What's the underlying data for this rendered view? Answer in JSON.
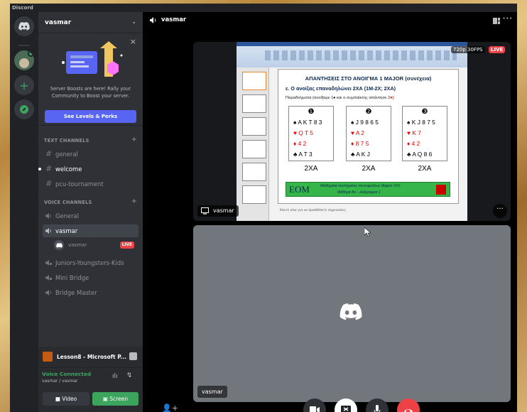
{
  "app": {
    "title": "Discord"
  },
  "server": {
    "name": "vasmar"
  },
  "boost": {
    "text": "Server Boosts are here! Rally your Community to Boost your server.",
    "button": "See Levels & Perks"
  },
  "categories": {
    "text": "TEXT CHANNELS",
    "voice": "VOICE CHANNELS"
  },
  "text_channels": [
    {
      "name": "general"
    },
    {
      "name": "welcome"
    },
    {
      "name": "pcu-tournament"
    }
  ],
  "voice_channels": [
    {
      "name": "General"
    },
    {
      "name": "vasmar"
    },
    {
      "name": "Juniors-Youngsters-Kids"
    },
    {
      "name": "Mini Bridge"
    },
    {
      "name": "Bridge Master"
    }
  ],
  "voice_user": {
    "name": "vasmar",
    "badge": "LIVE"
  },
  "stream_panel": {
    "title": "Lesson8 - Microsoft P..."
  },
  "voice_status": {
    "status": "Voice Connected",
    "sub": "vasmar / vasmar"
  },
  "buttons": {
    "video": "Video",
    "screen": "Screen"
  },
  "main": {
    "channel": "vasmar"
  },
  "stream": {
    "quality": "720p 30FPS",
    "live": "LIVE",
    "user": "vasmar"
  },
  "slide": {
    "title": "ΑΠΑΝΤΗΣΕΙΣ ΣΤΟ ΑΝΟΙΓΜΑ 1 MAJOR (συνέχεια)",
    "subtitle": "ε. Ο ανοίξας επαναδηλώνει 2ΧΑ (1Μ-2Χ; 2ΧΑ)",
    "example_pre": "Παραδείγματα (ανοίξαμε 1",
    "example_mid": " και ο συμπαίκτης απάντησε 2",
    "example_post": "):",
    "hands": [
      {
        "num": "❶",
        "s": "♠ A K T 8 3",
        "h": "♥ Q T 5",
        "d": "♦ 4 2",
        "c": "♣ A T 3",
        "bid": "2XA"
      },
      {
        "num": "❷",
        "s": "♠ J 9 8 6 5",
        "h": "♥ A 2",
        "d": "♦ 8 7 5",
        "c": "♣ A K J",
        "bid": "2XA"
      },
      {
        "num": "❸",
        "s": "♠ K J 8 7 5",
        "h": "♥ K 7",
        "d": "♦ 4 2",
        "c": "♣ A Q 8 6",
        "bid": "2XA"
      }
    ],
    "logo": "EOM",
    "footer1": "Μαθήματα συστήματος πεντοφύλλων Majors 2XX",
    "footer2": "Μάθημα 8ο – Διάγραμμα 1",
    "notes": "Κάντε κλικ για να προσθέσετε σημειώσεις"
  },
  "user_tile": {
    "name": "vasmar"
  },
  "colors": {
    "blurple": "#5865f2",
    "green": "#3ba55d",
    "red": "#ed4245"
  }
}
